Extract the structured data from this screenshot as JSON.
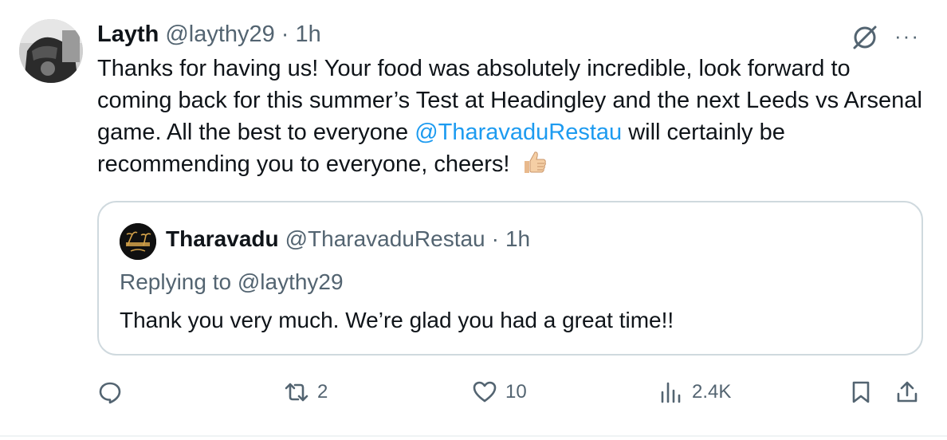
{
  "tweet": {
    "author_name": "Layth",
    "author_handle": "@laythy29",
    "separator": "·",
    "time": "1h",
    "more_label": "···",
    "text_part1": "Thanks for having us! Your food was absolutely incredible, look forward to coming back for this summer’s Test at Headingley and the next Leeds vs Arsenal game. All the best to everyone ",
    "mention": "@TharavaduRestau",
    "text_part2": " will certainly be recommending you to everyone, cheers! ",
    "emoji_icon": "thumbs-up-icon"
  },
  "quote": {
    "author_name": "Tharavadu",
    "author_handle": "@TharavaduRestau",
    "separator": "·",
    "time": "1h",
    "replying_to": "Replying to @laythy29",
    "text": "Thank you very much. We’re glad you had a great time!!"
  },
  "actions": {
    "reply_count": "",
    "retweet_count": "2",
    "like_count": "10",
    "views_count": "2.4K"
  },
  "colors": {
    "text": "#0f1419",
    "secondary": "#536471",
    "link": "#1d9bf0",
    "border": "#cfd9de"
  }
}
